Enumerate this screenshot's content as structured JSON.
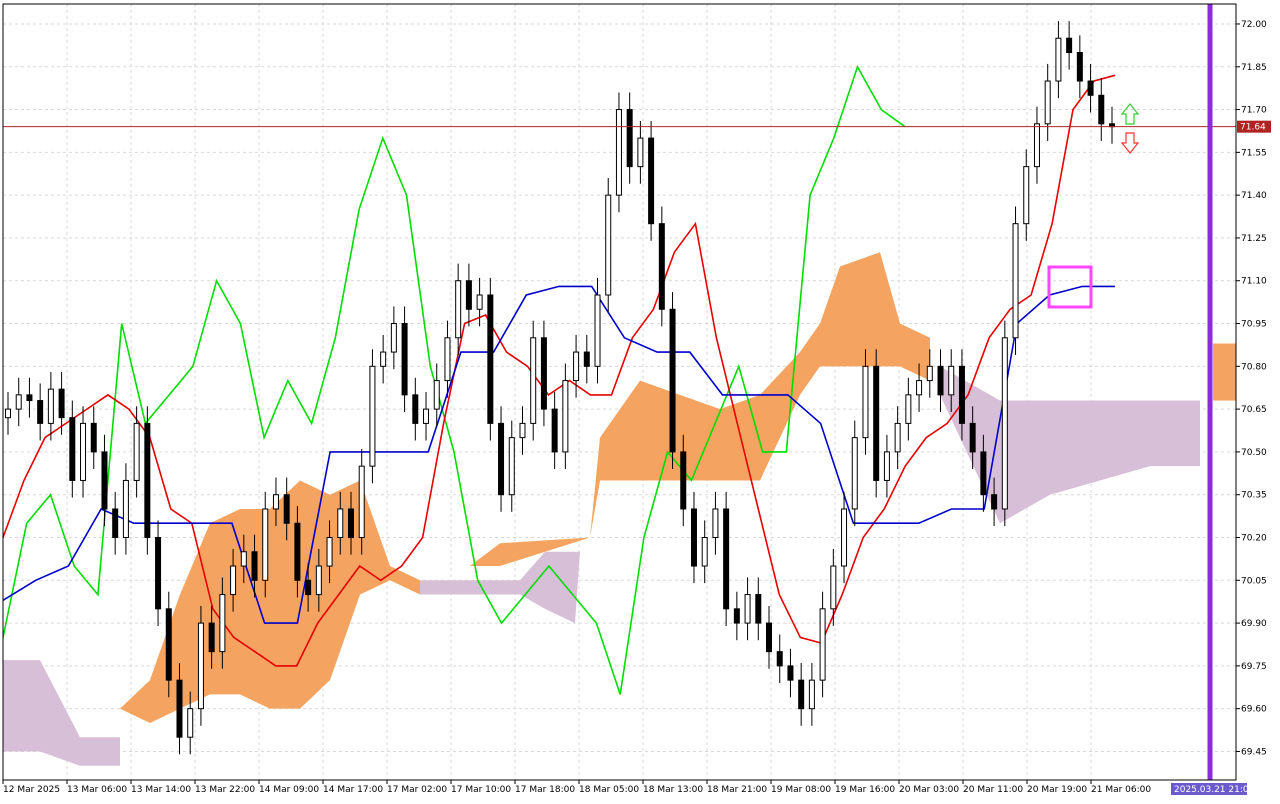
{
  "colors": {
    "background": "#ffffff",
    "grid": "#d9d9d9",
    "tenkan": "#e60000",
    "kijun": "#0000cc",
    "chikou": "#00dd00",
    "cloud_bull": "#f4a460",
    "cloud_bear": "#d8bfd8",
    "candle": "#000000",
    "candle_highlight": "#1f5fa8",
    "price_line": "#b22222",
    "now_line": "#8a2be2",
    "highlight_box": "#ff44ff",
    "arrow_up": "#33cc33",
    "arrow_down": "#ff3333",
    "date_badge": "#6a5acd"
  },
  "chart_data": {
    "type": "candlestick",
    "title": "",
    "ylim": [
      69.35,
      72.07
    ],
    "y_ticks": [
      "72.00",
      "71.85",
      "71.70",
      "71.55",
      "71.40",
      "71.25",
      "71.10",
      "70.95",
      "70.80",
      "70.65",
      "70.50",
      "70.35",
      "70.20",
      "70.05",
      "69.90",
      "69.75",
      "69.60",
      "69.45"
    ],
    "x_ticks": [
      "12 Mar 2025",
      "13 Mar 06:00",
      "13 Mar 14:00",
      "13 Mar 22:00",
      "14 Mar 09:00",
      "14 Mar 17:00",
      "17 Mar 02:00",
      "17 Mar 10:00",
      "17 Mar 18:00",
      "18 Mar 05:00",
      "18 Mar 13:00",
      "18 Mar 21:00",
      "19 Mar 08:00",
      "19 Mar 16:00",
      "20 Mar 03:00",
      "20 Mar 11:00",
      "20 Mar 19:00",
      "21 Mar 06:00"
    ],
    "current_price": 71.64,
    "current_price_label": "71.64",
    "now_label": "2025.03.21 21:00",
    "signals": {
      "up_arrow": "up-arrow-icon",
      "down_arrow": "down-arrow-icon"
    },
    "candles_close": [
      70.65,
      70.7,
      70.68,
      70.6,
      70.72,
      70.62,
      70.4,
      70.6,
      70.5,
      70.3,
      70.2,
      70.4,
      70.6,
      70.2,
      69.95,
      69.7,
      69.5,
      69.6,
      69.9,
      69.8,
      70.0,
      70.1,
      70.15,
      70.05,
      70.3,
      70.35,
      70.25,
      70.05,
      70.0,
      70.1,
      70.2,
      70.3,
      70.2,
      70.45,
      70.8,
      70.85,
      70.95,
      70.7,
      70.6,
      70.65,
      70.75,
      70.9,
      71.1,
      71.0,
      71.05,
      70.6,
      70.35,
      70.55,
      70.6,
      70.9,
      70.65,
      70.5,
      70.75,
      70.85,
      70.8,
      71.05,
      71.4,
      71.7,
      71.5,
      71.6,
      71.3,
      71.0,
      70.5,
      70.3,
      70.1,
      70.2,
      70.3,
      69.95,
      69.9,
      70.0,
      69.9,
      69.8,
      69.75,
      69.7,
      69.6,
      69.7,
      69.95,
      70.1,
      70.3,
      70.55,
      70.8,
      70.4,
      70.5,
      70.6,
      70.7,
      70.75,
      70.8,
      70.7,
      70.8,
      70.6,
      70.5,
      70.35,
      70.3,
      70.9,
      71.3,
      71.5,
      71.65,
      71.8,
      71.95,
      71.9,
      71.8,
      71.75,
      71.65,
      71.64
    ],
    "tenkan": [
      70.2,
      70.4,
      70.55,
      70.6,
      70.65,
      70.7,
      70.65,
      70.55,
      70.3,
      70.25,
      69.95,
      69.85,
      69.8,
      69.75,
      69.75,
      69.9,
      70.0,
      70.1,
      70.05,
      70.1,
      70.2,
      70.6,
      70.95,
      70.98,
      70.85,
      70.8,
      70.7,
      70.75,
      70.7,
      70.7,
      70.9,
      71.0,
      71.2,
      71.3,
      70.9,
      70.6,
      70.3,
      70.0,
      69.85,
      69.83,
      70.0,
      70.2,
      70.3,
      70.45,
      70.55,
      70.6,
      70.7,
      70.9,
      71.0,
      71.05,
      71.3,
      71.7,
      71.8,
      71.82
    ],
    "kijun": [
      69.98,
      70.05,
      70.1,
      70.3,
      70.25,
      70.25,
      70.25,
      70.25,
      69.9,
      69.9,
      70.5,
      70.5,
      70.5,
      70.5,
      70.85,
      70.85,
      71.05,
      71.08,
      71.08,
      70.9,
      70.85,
      70.85,
      70.7,
      70.7,
      70.7,
      70.6,
      70.25,
      70.25,
      70.25,
      70.3,
      70.3,
      70.95,
      71.05,
      71.08,
      71.08
    ],
    "chikou": [
      69.85,
      70.25,
      70.35,
      70.1,
      70.0,
      70.95,
      70.6,
      70.7,
      70.8,
      71.1,
      70.95,
      70.55,
      70.75,
      70.6,
      70.9,
      71.35,
      71.6,
      71.4,
      70.8,
      70.5,
      70.05,
      69.9,
      70.0,
      70.1,
      70.0,
      69.9,
      69.65,
      70.2,
      70.5,
      70.4,
      70.6,
      70.8,
      70.5,
      70.5,
      71.4,
      71.6,
      71.85,
      71.7,
      71.64
    ]
  }
}
